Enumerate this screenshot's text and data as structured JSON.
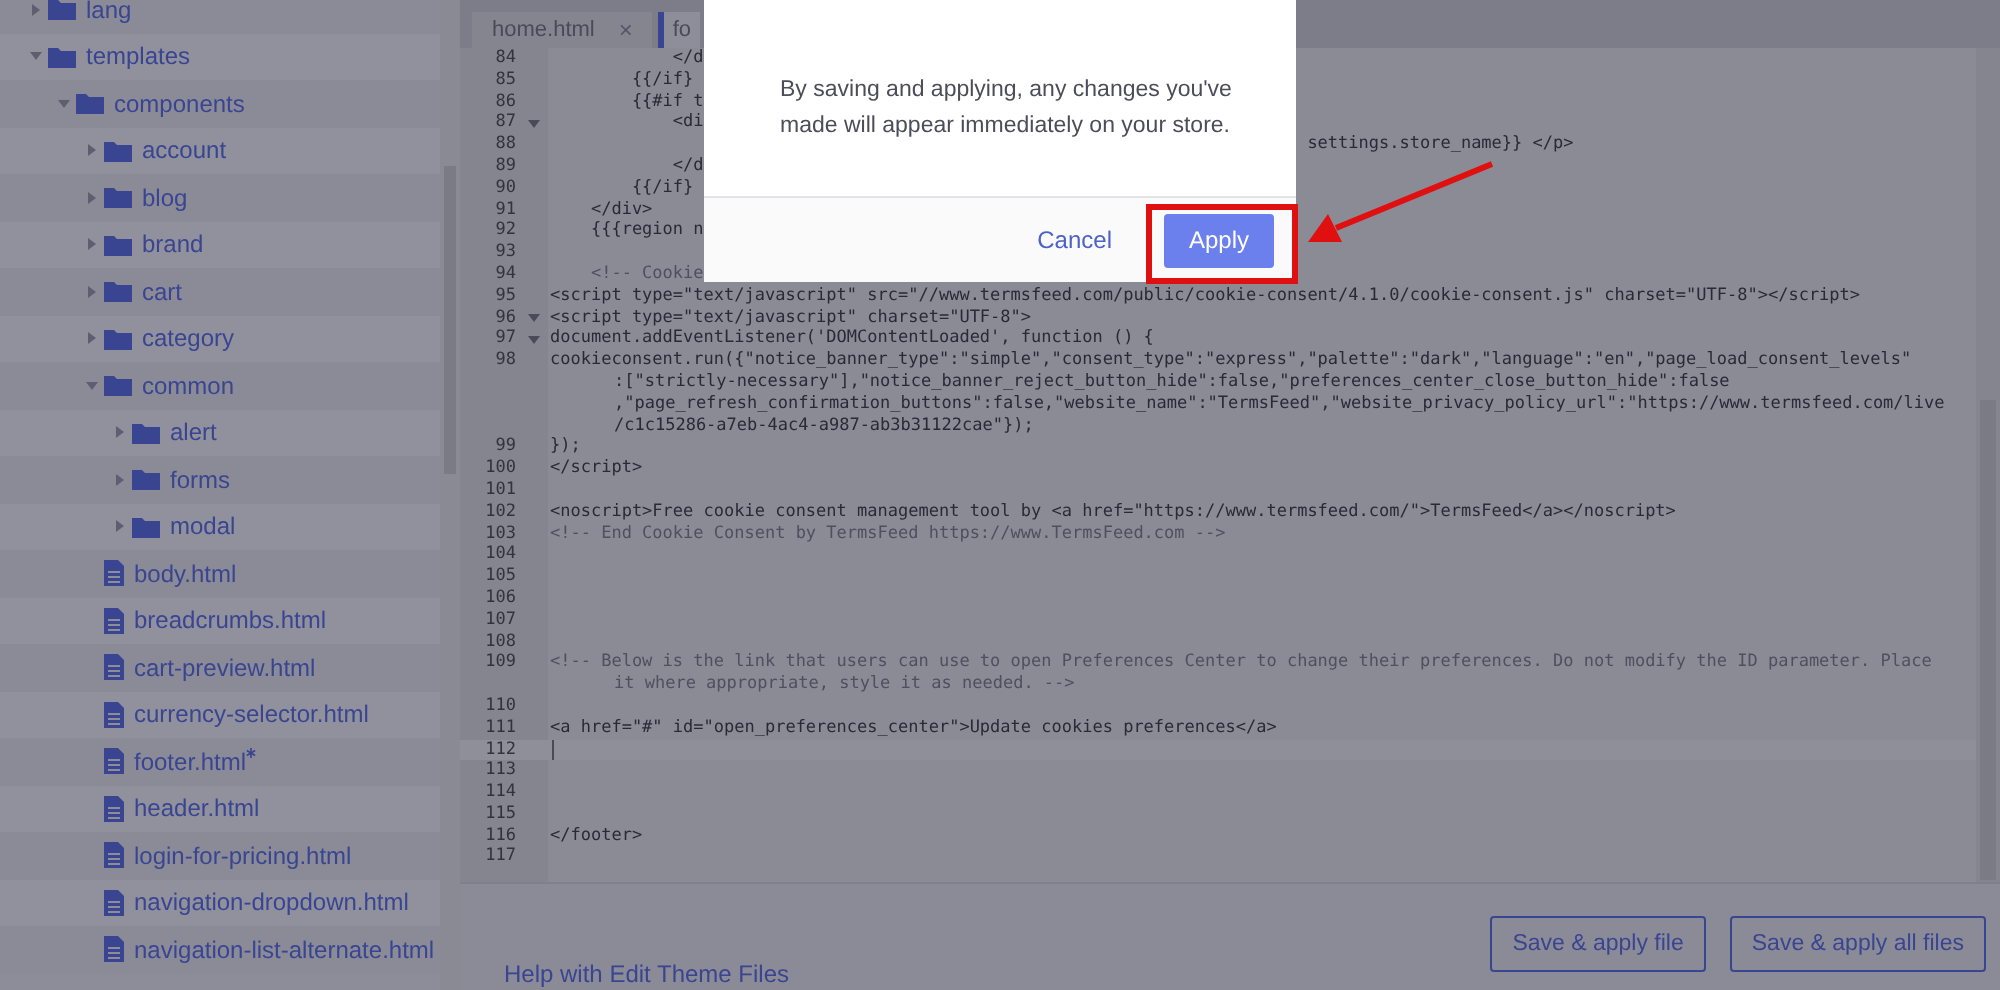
{
  "sidebar": {
    "tree": [
      {
        "label": "lang",
        "kind": "folder",
        "expanded": false
      },
      {
        "label": "templates",
        "kind": "folder",
        "expanded": true,
        "children": [
          {
            "label": "components",
            "kind": "folder",
            "expanded": true,
            "children": [
              {
                "label": "account",
                "kind": "folder",
                "expanded": false
              },
              {
                "label": "blog",
                "kind": "folder",
                "expanded": false
              },
              {
                "label": "brand",
                "kind": "folder",
                "expanded": false
              },
              {
                "label": "cart",
                "kind": "folder",
                "expanded": false
              },
              {
                "label": "category",
                "kind": "folder",
                "expanded": false
              },
              {
                "label": "common",
                "kind": "folder",
                "expanded": true,
                "children": [
                  {
                    "label": "alert",
                    "kind": "folder",
                    "expanded": false
                  },
                  {
                    "label": "forms",
                    "kind": "folder",
                    "expanded": false
                  },
                  {
                    "label": "modal",
                    "kind": "folder",
                    "expanded": false
                  }
                ]
              },
              {
                "label": "body.html",
                "kind": "file",
                "modified": false
              },
              {
                "label": "breadcrumbs.html",
                "kind": "file",
                "modified": false
              },
              {
                "label": "cart-preview.html",
                "kind": "file",
                "modified": false
              },
              {
                "label": "currency-selector.html",
                "kind": "file",
                "modified": false
              },
              {
                "label": "footer.html",
                "kind": "file",
                "modified": true
              },
              {
                "label": "header.html",
                "kind": "file",
                "modified": false
              },
              {
                "label": "login-for-pricing.html",
                "kind": "file",
                "modified": false
              },
              {
                "label": "navigation-dropdown.html",
                "kind": "file",
                "modified": false
              },
              {
                "label": "navigation-list-alternate.html",
                "kind": "file",
                "modified": false
              }
            ]
          }
        ]
      }
    ]
  },
  "editor": {
    "tabs": [
      {
        "label": "home.html",
        "close": "×",
        "selected": false
      },
      {
        "label": "fo",
        "selected": true
      }
    ],
    "lines": [
      {
        "number": "84",
        "kind": "code",
        "text": "            </d"
      },
      {
        "number": "85",
        "kind": "code",
        "text": "        {{/if}"
      },
      {
        "number": "86",
        "kind": "code",
        "text": "        {{#if t"
      },
      {
        "number": "87",
        "kind": "code",
        "fold": true,
        "text": "            <di"
      },
      {
        "number": "88",
        "kind": "code",
        "tail": "settings.store_name}} </p>"
      },
      {
        "number": "89",
        "kind": "code",
        "text": "            </d"
      },
      {
        "number": "90",
        "kind": "code",
        "text": "        {{/if}"
      },
      {
        "number": "91",
        "kind": "code",
        "text": "    </div>"
      },
      {
        "number": "92",
        "kind": "code",
        "text": "    {{{region n"
      },
      {
        "number": "93",
        "kind": "blank"
      },
      {
        "number": "94",
        "kind": "comment",
        "text": "    <!-- Cookie"
      },
      {
        "number": "95",
        "kind": "code",
        "text": "<script type=\"text/javascript\" src=\"//www.termsfeed.com/public/cookie-consent/4.1.0/cookie-consent.js\" charset=\"UTF-8\"></script>"
      },
      {
        "number": "96",
        "kind": "code",
        "fold": true,
        "text": "<script type=\"text/javascript\" charset=\"UTF-8\">"
      },
      {
        "number": "97",
        "kind": "code",
        "fold": true,
        "text": "document.addEventListener('DOMContentLoaded', function () {"
      },
      {
        "number": "98",
        "kind": "code",
        "text": "cookieconsent.run({\"notice_banner_type\":\"simple\",\"consent_type\":\"express\",\"palette\":\"dark\",\"language\":\"en\",\"page_load_consent_levels\"",
        "wraps": [
          ":[\"strictly-necessary\"],\"notice_banner_reject_button_hide\":false,\"preferences_center_close_button_hide\":false",
          ",\"page_refresh_confirmation_buttons\":false,\"website_name\":\"TermsFeed\",\"website_privacy_policy_url\":\"https://www.termsfeed.com/live",
          "/c1c15286-a7eb-4ac4-a987-ab3b31122cae\"});"
        ]
      },
      {
        "number": "99",
        "kind": "code",
        "text": "});"
      },
      {
        "number": "100",
        "kind": "code",
        "text": "</script>"
      },
      {
        "number": "101",
        "kind": "blank"
      },
      {
        "number": "102",
        "kind": "code",
        "text": "<noscript>Free cookie consent management tool by <a href=\"https://www.termsfeed.com/\">TermsFeed</a></noscript>"
      },
      {
        "number": "103",
        "kind": "comment",
        "text": "<!-- End Cookie Consent by TermsFeed https://www.TermsFeed.com -->"
      },
      {
        "number": "104",
        "kind": "blank"
      },
      {
        "number": "105",
        "kind": "blank"
      },
      {
        "number": "106",
        "kind": "blank"
      },
      {
        "number": "107",
        "kind": "blank"
      },
      {
        "number": "108",
        "kind": "blank"
      },
      {
        "number": "109",
        "kind": "comment",
        "text": "<!-- Below is the link that users can use to open Preferences Center to change their preferences. Do not modify the ID parameter. Place",
        "wraps": [
          "it where appropriate, style it as needed. -->"
        ]
      },
      {
        "number": "110",
        "kind": "blank"
      },
      {
        "number": "111",
        "kind": "code",
        "text": "<a href=\"#\" id=\"open_preferences_center\">Update cookies preferences</a>"
      },
      {
        "number": "112",
        "kind": "blank",
        "current": true
      },
      {
        "number": "113",
        "kind": "blank"
      },
      {
        "number": "114",
        "kind": "blank"
      },
      {
        "number": "115",
        "kind": "blank"
      },
      {
        "number": "116",
        "kind": "code",
        "text": "</footer>"
      },
      {
        "number": "117",
        "kind": "blank"
      }
    ]
  },
  "footer": {
    "help_link": "Help with Edit Theme Files",
    "buttons": [
      "Save & apply file",
      "Save & apply all files"
    ]
  },
  "modal": {
    "message": "By saving and applying, any changes you've made will appear immediately on your store.",
    "cancel": "Cancel",
    "apply": "Apply"
  }
}
